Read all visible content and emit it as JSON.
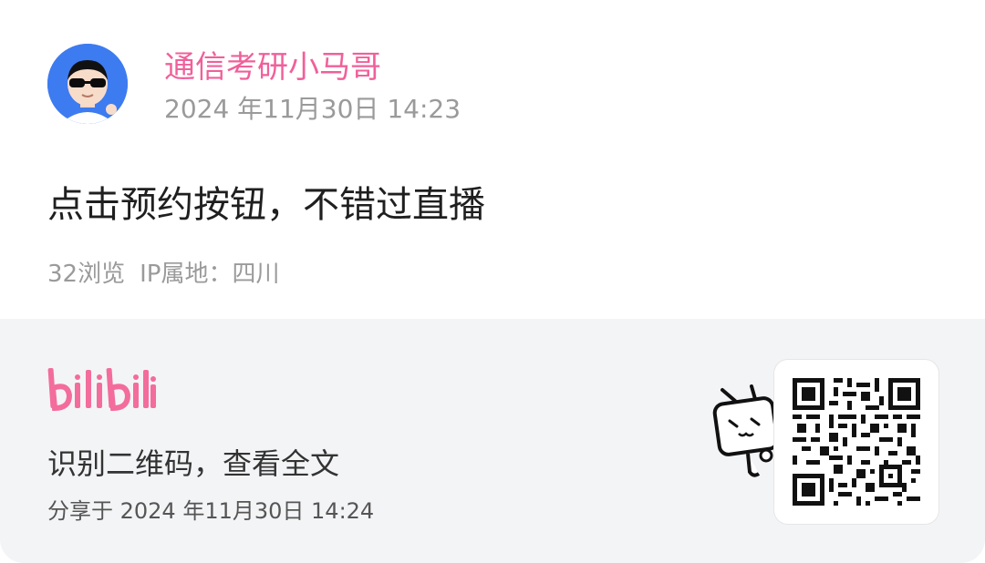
{
  "post": {
    "username": "通信考研小马哥",
    "time": "2024 年11月30日 14:23",
    "content": "点击预约按钮，不错过直播",
    "views": "32浏览",
    "ip_location": "IP属地：四川"
  },
  "share": {
    "brand": "bilibili",
    "cta": "识别二维码，查看全文",
    "time": "分享于 2024 年11月30日 14:24"
  },
  "colors": {
    "accent": "#f0609a",
    "footer_bg": "#f3f4f6"
  },
  "icons": {
    "avatar": "avatar-sunglasses",
    "brand": "bilibili-logo",
    "mascot": "bilibili-tv-mascot",
    "qr": "qr-code"
  }
}
